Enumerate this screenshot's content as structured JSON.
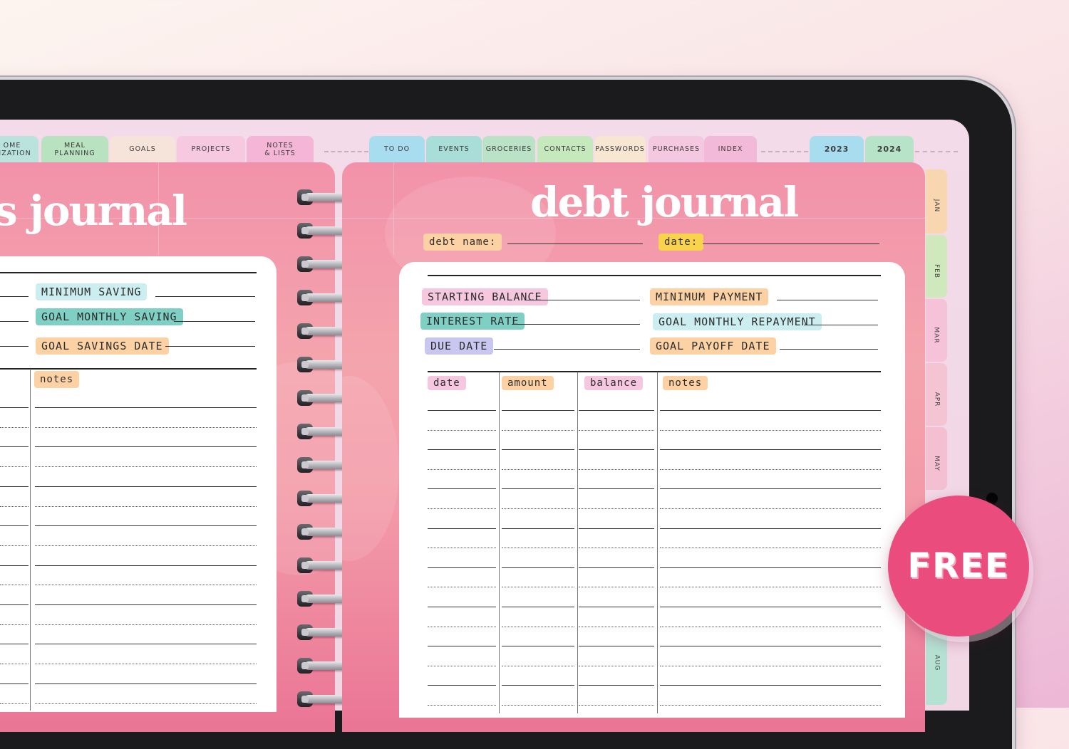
{
  "top_tabs": [
    {
      "label": "OME\nNIZATION",
      "color": "#b9e3dc"
    },
    {
      "label": "MEAL\nPLANNING",
      "color": "#b9e3c0"
    },
    {
      "label": "GOALS",
      "color": "#f6e3da"
    },
    {
      "label": "PROJECTS",
      "color": "#f6c9e0"
    },
    {
      "label": "NOTES\n& LISTS",
      "color": "#f4b5d6"
    },
    {
      "label": "TO DO",
      "color": "#a8dcef"
    },
    {
      "label": "EVENTS",
      "color": "#a9ddd8"
    },
    {
      "label": "GROCERIES",
      "color": "#b9e2c6"
    },
    {
      "label": "CONTACTS",
      "color": "#c5e8bc"
    },
    {
      "label": "PASSWORDS",
      "color": "#f6e6d2"
    },
    {
      "label": "PURCHASES",
      "color": "#f4c8e0"
    },
    {
      "label": "INDEX",
      "color": "#f3b9d9"
    }
  ],
  "year_tabs": [
    {
      "label": "2023",
      "color": "#a8dcef"
    },
    {
      "label": "2024",
      "color": "#b7e4c8"
    }
  ],
  "month_tabs": [
    {
      "label": "JAN",
      "color": "#f7d6b0"
    },
    {
      "label": "FEB",
      "color": "#cfe9bd"
    },
    {
      "label": "MAR",
      "color": "#f6c2d8"
    },
    {
      "label": "APR",
      "color": "#f4c4d3"
    },
    {
      "label": "MAY",
      "color": "#f3bfd1"
    },
    {
      "label": "AUG",
      "color": "#b5e1d3"
    }
  ],
  "left_page": {
    "title": "s journal",
    "pills": [
      {
        "label": "MINIMUM SAVING",
        "color": "#cdeef0"
      },
      {
        "label": "GOAL MONTHLY SAVING",
        "color": "#7fcfc4"
      },
      {
        "label": "GOAL SAVINGS DATE",
        "color": "#fcd2a4"
      }
    ],
    "notes_header": "notes",
    "notes_color": "#fcd2a4"
  },
  "right_page": {
    "title": "debt journal",
    "debt_name_label": "debt name:",
    "debt_name_color": "#fcd2a4",
    "date_label": "date:",
    "date_color": "#f9d34c",
    "fields_left": [
      {
        "label": "STARTING BALANCE",
        "color": "#f6c8e0"
      },
      {
        "label": "INTEREST RATE",
        "color": "#7fcfc4"
      },
      {
        "label": "DUE DATE",
        "color": "#c9c7ef"
      }
    ],
    "fields_right": [
      {
        "label": "MINIMUM PAYMENT",
        "color": "#fcd2a4"
      },
      {
        "label": "GOAL MONTHLY REPAYMENT",
        "color": "#cdeef0"
      },
      {
        "label": "GOAL PAYOFF DATE",
        "color": "#fcd2a4"
      }
    ],
    "columns": [
      {
        "label": "date",
        "color": "#f6c8e0"
      },
      {
        "label": "amount",
        "color": "#fcd2a4"
      },
      {
        "label": "balance",
        "color": "#f6c8e0"
      },
      {
        "label": "notes",
        "color": "#fcd2a4"
      }
    ]
  },
  "badge": {
    "label": "FREE",
    "color": "#ea4d7d"
  }
}
